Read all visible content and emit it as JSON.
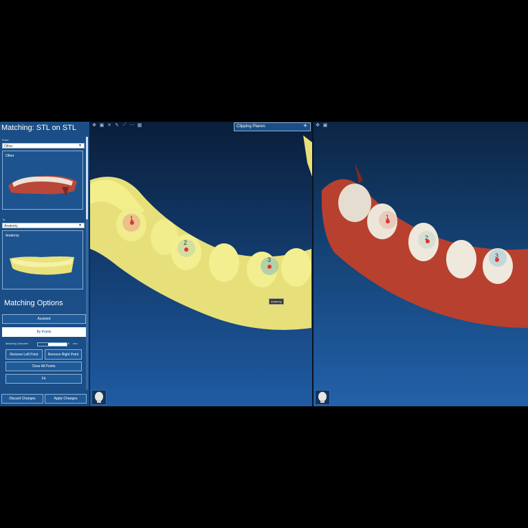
{
  "panel": {
    "title": "Matching: STL on STL",
    "from_label": "From:",
    "from_value": "Other",
    "from_preview_label": "Other",
    "to_label": "To:",
    "to_value": "Anatomy",
    "to_preview_label": "Anatomy",
    "section_title": "Matching Options",
    "assisted_label": "Assisted",
    "by_points_label": "By Points",
    "diameter_label": "Matching Diameter",
    "diameter_value": "6",
    "diameter_unit": "mm",
    "diameter_fraction": 0.35,
    "remove_left_label": "Remove Left Point",
    "remove_right_label": "Remove Right Point",
    "clear_all_label": "Clear All Points",
    "fit_label": "Fit",
    "discard_label": "Discard Changes",
    "apply_label": "Apply Changes"
  },
  "viewport_left": {
    "clipping_label": "Clipping Planes",
    "plus_icon": "+",
    "anatomy_tag": "Anatomy",
    "points": [
      "1",
      "2",
      "3"
    ]
  },
  "viewport_right": {
    "points": [
      "1",
      "2",
      "3"
    ]
  },
  "colors": {
    "panel": "#1b4e86",
    "anatomy_model": "#f3ef8a",
    "tooth": "#efe8dc",
    "gum": "#b8402f",
    "point_marker": "#e23434"
  },
  "icons": [
    "move-icon",
    "fit-view-icon",
    "cross-icon",
    "pen-icon",
    "ruler-icon",
    "grid-icon",
    "skull-icon",
    "chevron-down-icon",
    "plus-icon"
  ]
}
